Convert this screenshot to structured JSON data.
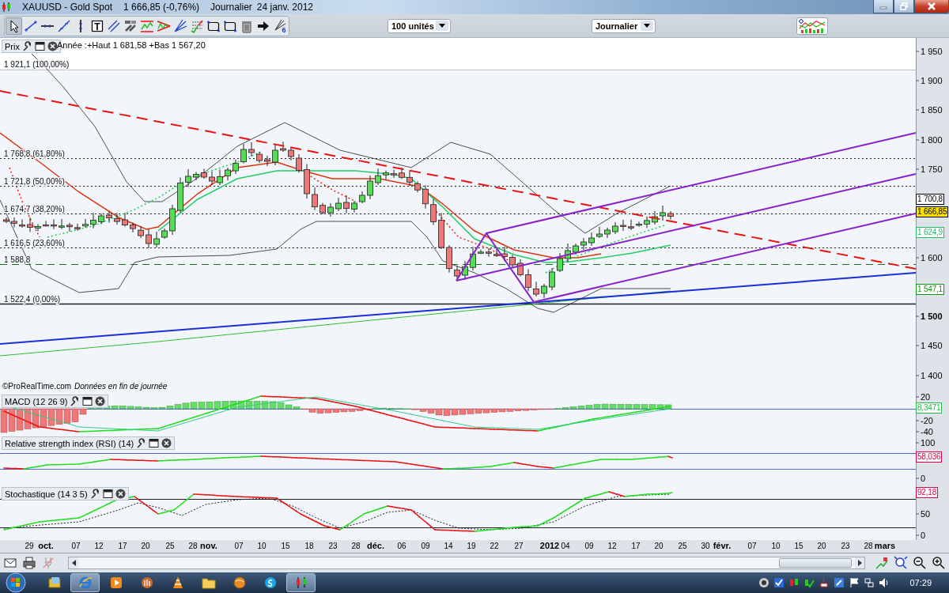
{
  "window": {
    "title": "XAUUSD - Gold Spot",
    "quote": "1 666,85 (-0,76%)",
    "period": "Journalier",
    "date": "24 janv. 2012"
  },
  "toolbar": {
    "tools": [
      {
        "kind": "pointer",
        "selected": true
      },
      {
        "kind": "segment",
        "selected": false
      },
      {
        "kind": "horizontal-line",
        "selected": false
      },
      {
        "kind": "trend-line",
        "selected": false
      },
      {
        "kind": "vertical-line",
        "selected": false
      },
      {
        "kind": "text",
        "glyph": "T",
        "selected": false
      },
      {
        "kind": "parallel",
        "selected": false
      },
      {
        "kind": "tools",
        "selected": false
      },
      {
        "kind": "channel",
        "selected": false
      },
      {
        "kind": "triangle",
        "selected": false
      },
      {
        "kind": "fan",
        "selected": false
      },
      {
        "kind": "fibonacci",
        "selected": false
      },
      {
        "kind": "rectangle",
        "selected": false
      },
      {
        "kind": "rectangle",
        "selected": false
      },
      {
        "kind": "trash",
        "selected": false
      },
      {
        "kind": "arrow",
        "selected": false
      },
      {
        "kind": "multi",
        "glyph": "6",
        "selected": false
      }
    ],
    "units": "100 unités",
    "period": "Journalier"
  },
  "price_panel": {
    "title": "Prix",
    "range": "Année :+Haut 1 681,58 +Bas 1 567,20",
    "fib_levels": [
      {
        "label": "1 921,1 (100,00%)",
        "kind": "solid"
      },
      {
        "label": "1 768,8 (61,80%)",
        "kind": "dotted"
      },
      {
        "label": "1 721,8 (50,00%)",
        "kind": "dotted"
      },
      {
        "label": "1 674,7 (38,20%)",
        "kind": "dotted"
      },
      {
        "label": "1 616,5 (23,60%)",
        "kind": "dotted"
      },
      {
        "label": "1 588,8",
        "kind": "dashed"
      },
      {
        "label": "1 522,4 (0,00%)",
        "kind": "solid"
      }
    ],
    "y_ticks": [
      {
        "label": "1 950",
        "major": false
      },
      {
        "label": "1 900",
        "major": false
      },
      {
        "label": "1 850",
        "major": false
      },
      {
        "label": "1 800",
        "major": false
      },
      {
        "label": "1 750",
        "major": false
      },
      {
        "label": "1 600",
        "major": false
      },
      {
        "label": "1 500",
        "major": true
      },
      {
        "label": "1 450",
        "major": false
      },
      {
        "label": "1 400",
        "major": false
      }
    ],
    "tags": [
      {
        "text": "1 700,8",
        "color": "#000000",
        "highlighted": false
      },
      {
        "text": "1 666,85",
        "color": "#000000",
        "highlighted": true
      },
      {
        "text": "1 624,9",
        "color": "#22bb66",
        "highlighted": false
      },
      {
        "text": "1 547,1",
        "color": "#119911",
        "highlighted": false
      }
    ],
    "credit": "©ProRealTime.com",
    "note": "Données en fin de journée"
  },
  "indicators": [
    {
      "title": "MACD (12 26 9)",
      "y_ticks": [
        "20",
        "-20",
        "-40"
      ],
      "tags": [
        {
          "text": "8,3471",
          "color": "#22bb44"
        }
      ]
    },
    {
      "title": "Relative strength index (RSI) (14)",
      "y_ticks": [
        "100",
        "0"
      ],
      "tags": [
        {
          "text": "58,036",
          "color": "#dd0044"
        }
      ]
    },
    {
      "title": "Stochastique (14 3 5)",
      "y_ticks": [
        "50",
        "0"
      ],
      "tags": [
        {
          "text": "92,18",
          "color": "#dd0044"
        }
      ]
    }
  ],
  "x_axis": [
    {
      "label": "29",
      "kind": "day"
    },
    {
      "label": "oct.",
      "kind": "month"
    },
    {
      "label": "07",
      "kind": "day"
    },
    {
      "label": "12",
      "kind": "day"
    },
    {
      "label": "17",
      "kind": "day"
    },
    {
      "label": "20",
      "kind": "day"
    },
    {
      "label": "25",
      "kind": "day"
    },
    {
      "label": "28",
      "kind": "day"
    },
    {
      "label": "nov.",
      "kind": "month"
    },
    {
      "label": "07",
      "kind": "day"
    },
    {
      "label": "10",
      "kind": "day"
    },
    {
      "label": "15",
      "kind": "day"
    },
    {
      "label": "18",
      "kind": "day"
    },
    {
      "label": "23",
      "kind": "day"
    },
    {
      "label": "28",
      "kind": "day"
    },
    {
      "label": "déc.",
      "kind": "month"
    },
    {
      "label": "06",
      "kind": "day"
    },
    {
      "label": "09",
      "kind": "day"
    },
    {
      "label": "14",
      "kind": "day"
    },
    {
      "label": "19",
      "kind": "day"
    },
    {
      "label": "22",
      "kind": "day"
    },
    {
      "label": "27",
      "kind": "day"
    },
    {
      "label": "2012",
      "kind": "month"
    },
    {
      "label": "04",
      "kind": "day"
    },
    {
      "label": "09",
      "kind": "day"
    },
    {
      "label": "12",
      "kind": "day"
    },
    {
      "label": "17",
      "kind": "day"
    },
    {
      "label": "20",
      "kind": "day"
    },
    {
      "label": "25",
      "kind": "day"
    },
    {
      "label": "30",
      "kind": "day"
    },
    {
      "label": "févr.",
      "kind": "month"
    },
    {
      "label": "07",
      "kind": "day"
    },
    {
      "label": "10",
      "kind": "day"
    },
    {
      "label": "15",
      "kind": "day"
    },
    {
      "label": "20",
      "kind": "day"
    },
    {
      "label": "23",
      "kind": "day"
    },
    {
      "label": "28",
      "kind": "day"
    },
    {
      "label": "mars",
      "kind": "month"
    }
  ],
  "taskbar": {
    "apps": [
      {
        "kind": "library",
        "active": false
      },
      {
        "kind": "browser",
        "active": true
      },
      {
        "kind": "media",
        "active": false
      },
      {
        "kind": "app",
        "active": false
      },
      {
        "kind": "cone",
        "active": false
      },
      {
        "kind": "folder",
        "active": false
      },
      {
        "kind": "globe",
        "active": false
      },
      {
        "kind": "chat",
        "active": false
      },
      {
        "kind": "chart",
        "active": true
      }
    ],
    "clock": "07:29"
  }
}
